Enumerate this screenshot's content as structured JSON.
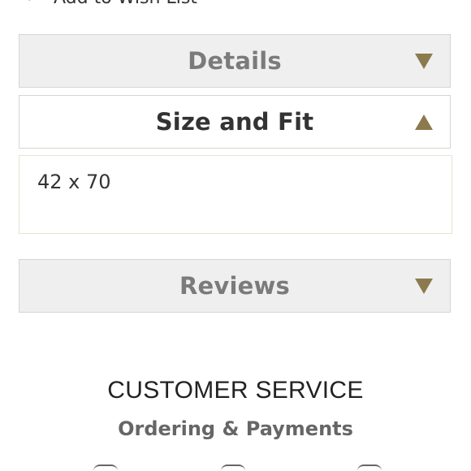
{
  "wishlist": {
    "label": "Add to Wish List",
    "icon": "heart-icon"
  },
  "accordion": {
    "details": {
      "title": "Details",
      "state": "collapsed",
      "icon": "caret-down-icon"
    },
    "size_fit": {
      "title": "Size and Fit",
      "state": "expanded",
      "icon": "caret-up-icon",
      "content": "42 x 70"
    },
    "reviews": {
      "title": "Reviews",
      "state": "collapsed",
      "icon": "caret-down-icon"
    }
  },
  "customer_service": {
    "heading": "CUSTOMER SERVICE",
    "first_link": "Ordering & Payments"
  },
  "colors": {
    "accent": "#8a7a4e",
    "closed_panel_bg": "#efefef",
    "border": "#d5d5d5"
  }
}
